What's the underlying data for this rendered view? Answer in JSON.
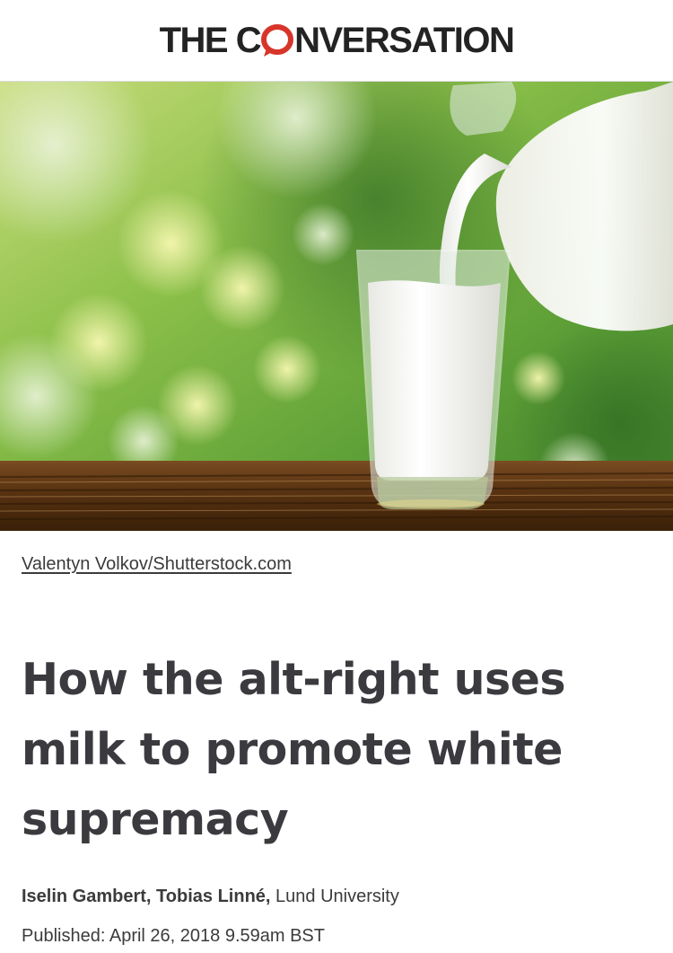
{
  "masthead": {
    "logo_part1": "THE C",
    "logo_part2": "NVERSATION",
    "logo_accent_color": "#d8352a",
    "logo_o_icon": "speech-bubble-o-icon"
  },
  "hero": {
    "image_subject": "milk-pouring-photo",
    "credit": "Valentyn Volkov/Shutterstock.com"
  },
  "article": {
    "headline_line1": "How the alt-right uses",
    "headline_line2": "milk to promote white",
    "headline_line3": "supremacy",
    "authors": "Iselin Gambert, Tobias Linné,",
    "institution": " Lund University",
    "published": "Published: April 26, 2018 9.59am BST"
  }
}
